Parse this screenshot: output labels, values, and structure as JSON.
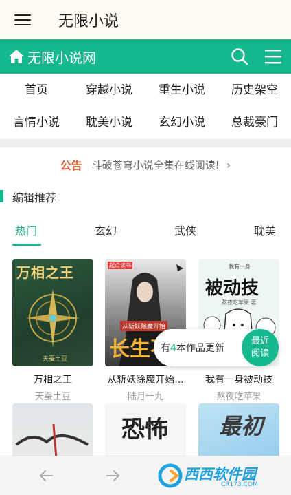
{
  "app_bar": {
    "title": "无限小说",
    "menu_icon": "hamburger-menu-icon"
  },
  "site_header": {
    "title": "无限小说网",
    "icons": [
      "home-icon",
      "search-icon",
      "list-menu-icon"
    ],
    "color": "#16b88e"
  },
  "nav": {
    "row1": [
      "首页",
      "穿越小说",
      "重生小说",
      "历史架空"
    ],
    "row2": [
      "言情小说",
      "耽美小说",
      "玄幻小说",
      "总裁豪门"
    ]
  },
  "notice": {
    "tag": "公告",
    "text": "斗破苍穹小说全集在线阅读!",
    "arrow": "›"
  },
  "section": {
    "title": "编辑推荐"
  },
  "tabs": [
    "热门",
    "玄幻",
    "武侠",
    "耽美"
  ],
  "active_tab": "热门",
  "books": [
    {
      "title": "万相之王",
      "author": "天蚕土豆",
      "cover_title": "万相之王",
      "cover_sub": "天蚕土豆"
    },
    {
      "title": "从斩妖除魔开始...",
      "author": "陆月十九",
      "cover_title": "长生不",
      "cover_sub": "从斩妖除魔开始",
      "cover_badge": "起点读书"
    },
    {
      "title": "我有一身被动技",
      "author": "熬夜吃苹果",
      "cover_title": "被动技",
      "cover_sub": "我有一身",
      "cover_author": "熬夜吃苹果 著"
    },
    {
      "title": "",
      "author": "",
      "cover_title": ""
    },
    {
      "title": "",
      "author": "",
      "cover_title": "恐怖"
    },
    {
      "title": "",
      "author": "",
      "cover_title": "最初"
    }
  ],
  "popup": {
    "prefix": "有",
    "count": "4",
    "suffix": "本作品更新",
    "button_line1": "最近",
    "button_line2": "阅读"
  },
  "bottom_bar": {
    "icons": [
      "back-arrow-icon",
      "forward-arrow-icon"
    ]
  },
  "watermark": {
    "text": "西西软件园",
    "sub": "CR173.COM"
  }
}
